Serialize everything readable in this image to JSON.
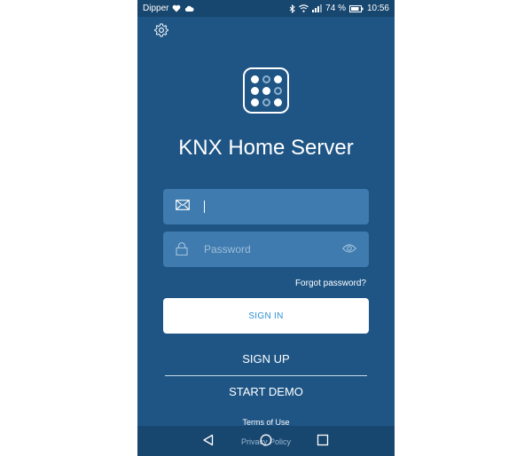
{
  "status_bar": {
    "carrier": "Dipper",
    "battery": "74 %",
    "time": "10:56"
  },
  "app": {
    "title": "KNX Home Server"
  },
  "login": {
    "email_value": "",
    "email_placeholder": "",
    "password_placeholder": "Password",
    "forgot_label": "Forgot password?",
    "signin_label": "SIGN IN"
  },
  "actions": {
    "signup_label": "SIGN UP",
    "demo_label": "START DEMO"
  },
  "footer": {
    "terms_label": "Terms of Use",
    "privacy_label": "Privacy Policy"
  },
  "icons": {
    "settings": "gear-icon",
    "email": "envelope-icon",
    "password": "lock-icon",
    "reveal": "eye-icon"
  },
  "colors": {
    "background": "#1e5585",
    "field": "#3f7bae",
    "bar": "#17466f",
    "button_text": "#2f8fd6"
  }
}
